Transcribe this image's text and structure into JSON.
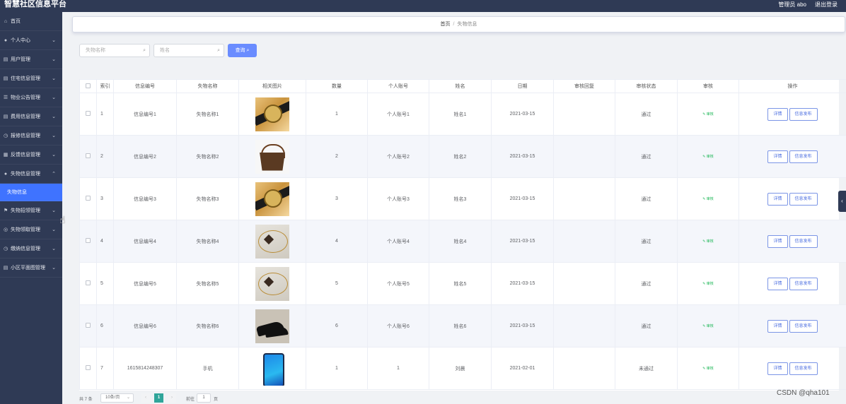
{
  "header": {
    "title": "智慧社区信息平台",
    "user_label": "管理员 abo",
    "logout_label": "退出登录"
  },
  "sidebar": {
    "items": [
      {
        "label": "首页",
        "icon": "home-icon",
        "glyph": "⌂",
        "chevron": ""
      },
      {
        "label": "个人中心",
        "icon": "user-icon",
        "glyph": "●",
        "chevron": "⌄"
      },
      {
        "label": "用户管理",
        "icon": "list-icon",
        "glyph": "▤",
        "chevron": "⌄"
      },
      {
        "label": "住宅信息管理",
        "icon": "list-icon",
        "glyph": "▤",
        "chevron": "⌄"
      },
      {
        "label": "物业公告管理",
        "icon": "settings-icon",
        "glyph": "☰",
        "chevron": "⌄"
      },
      {
        "label": "费用信息管理",
        "icon": "list-icon",
        "glyph": "▤",
        "chevron": "⌄"
      },
      {
        "label": "报修信息管理",
        "icon": "clock-icon",
        "glyph": "◷",
        "chevron": "⌄"
      },
      {
        "label": "反馈信息管理",
        "icon": "grid-icon",
        "glyph": "▦",
        "chevron": "⌄"
      },
      {
        "label": "失物信息管理",
        "icon": "user-icon",
        "glyph": "●",
        "chevron": "⌃"
      },
      {
        "label": "失物信息",
        "icon": "",
        "glyph": "",
        "chevron": ""
      },
      {
        "label": "失物招领管理",
        "icon": "flag-icon",
        "glyph": "⚑",
        "chevron": "⌄"
      },
      {
        "label": "失物领取管理",
        "icon": "circle-icon",
        "glyph": "◎",
        "chevron": "⌄"
      },
      {
        "label": "缴纳信息管理",
        "icon": "clock-icon",
        "glyph": "◷",
        "chevron": "⌄"
      },
      {
        "label": "小区平面图管理",
        "icon": "list-icon",
        "glyph": "▤",
        "chevron": "⌄"
      }
    ],
    "active_sub_index": 9
  },
  "breadcrumb": {
    "home": "首页",
    "separator": "/",
    "current": "失物信息"
  },
  "search": {
    "item_name_placeholder": "失物名称",
    "name_placeholder": "姓名",
    "query_label": "查询"
  },
  "table": {
    "columns": [
      "索引",
      "信息编号",
      "失物名称",
      "相关图片",
      "数量",
      "个人账号",
      "姓名",
      "日期",
      "审核回复",
      "审核状态",
      "审核",
      "操作"
    ],
    "audit_label": "审核",
    "detail_label": "详情",
    "publish_label": "信息发布",
    "rows": [
      {
        "index": "1",
        "code": "信息编号1",
        "name": "失物名称1",
        "image": "img-watch",
        "qty": "1",
        "account": "个人账号1",
        "person": "姓名1",
        "date": "2021-03-15",
        "reply": "",
        "status": "通过"
      },
      {
        "index": "2",
        "code": "信息编号2",
        "name": "失物名称2",
        "image": "img-bag",
        "qty": "2",
        "account": "个人账号2",
        "person": "姓名2",
        "date": "2021-03-15",
        "reply": "",
        "status": "通过"
      },
      {
        "index": "3",
        "code": "信息编号3",
        "name": "失物名称3",
        "image": "img-watch",
        "qty": "3",
        "account": "个人账号3",
        "person": "姓名3",
        "date": "2021-03-15",
        "reply": "",
        "status": "通过"
      },
      {
        "index": "4",
        "code": "信息编号4",
        "name": "失物名称4",
        "image": "img-jewel",
        "qty": "4",
        "account": "个人账号4",
        "person": "姓名4",
        "date": "2021-03-15",
        "reply": "",
        "status": "通过"
      },
      {
        "index": "5",
        "code": "信息编号5",
        "name": "失物名称5",
        "image": "img-jewel",
        "qty": "5",
        "account": "个人账号5",
        "person": "姓名5",
        "date": "2021-03-15",
        "reply": "",
        "status": "通过"
      },
      {
        "index": "6",
        "code": "信息编号6",
        "name": "失物名称6",
        "image": "img-shoe",
        "qty": "6",
        "account": "个人账号6",
        "person": "姓名6",
        "date": "2021-03-15",
        "reply": "",
        "status": "通过"
      },
      {
        "index": "7",
        "code": "1615814248307",
        "name": "手机",
        "image": "img-phone",
        "qty": "1",
        "account": "1",
        "person": "刘晨",
        "date": "2021-02-01",
        "reply": "",
        "status": "未通过"
      }
    ]
  },
  "pagination": {
    "total": "共 7 条",
    "page_size": "10条/页",
    "prev": "‹",
    "current_page": "1",
    "next": "›",
    "goto_label": "前往",
    "goto_value": "1",
    "page_suffix": "页"
  },
  "watermark": "CSDN @qha101",
  "colors": {
    "sidebar_bg": "#2f3a55",
    "active_blue": "#3f73ff",
    "query_btn": "#6a8cff",
    "audit_green": "#21b85a",
    "pager_active": "#2fa59a"
  }
}
